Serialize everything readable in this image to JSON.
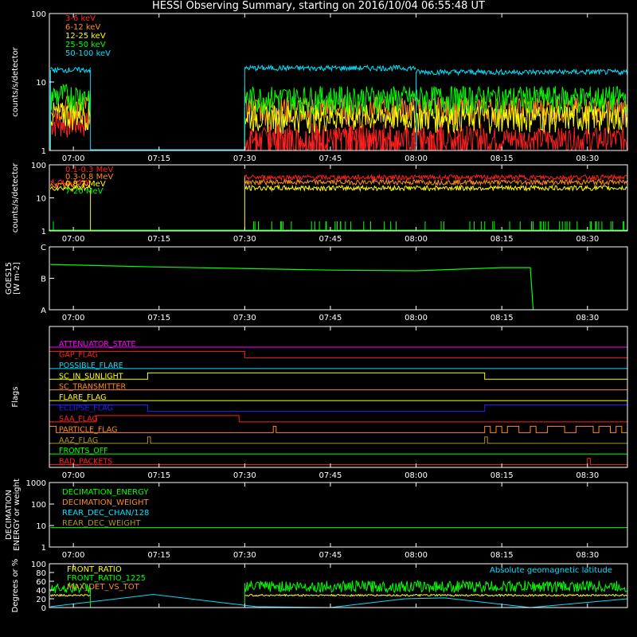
{
  "title": "HESSI Observing Summary, starting on 2016/10/04 06:55:48 UT",
  "time_axis": {
    "start": "06:55:48",
    "end": "08:37:00",
    "ticks": [
      "07:00",
      "07:15",
      "07:30",
      "07:45",
      "08:00",
      "08:15",
      "08:30"
    ]
  },
  "colors": {
    "red": "#ff2020",
    "orange": "#ff8c1a",
    "yellow": "#ffff00",
    "green": "#00ff00",
    "cyan": "#00e0ff",
    "magenta": "#ff00ff",
    "blue": "#2020ff",
    "olive": "#b09020",
    "white": "#ffffff"
  },
  "chart_data": [
    {
      "type": "line",
      "ylabel": "counts/s/detector",
      "yscale": "log",
      "ylim": [
        1,
        100
      ],
      "yticks": [
        "1",
        "10",
        "100"
      ],
      "legend": [
        {
          "name": "3-6 keV",
          "color": "#ff2020"
        },
        {
          "name": "6-12 keV",
          "color": "#ff8c1a"
        },
        {
          "name": "12-25 keV",
          "color": "#ffff00"
        },
        {
          "name": "25-50 keV",
          "color": "#00ff00"
        },
        {
          "name": "50-100 keV",
          "color": "#00e0ff"
        }
      ],
      "data_gap": [
        "07:03",
        "07:30"
      ],
      "series": [
        {
          "name": "3-6 keV",
          "color": "#ff2020",
          "segments": [
            {
              "from": "06:56",
              "to": "07:03",
              "level": 2.6
            },
            {
              "from": "07:30",
              "to": "08:37",
              "level": 1.5
            }
          ]
        },
        {
          "name": "6-12 keV",
          "color": "#ff8c1a",
          "segments": [
            {
              "from": "06:56",
              "to": "07:03",
              "level": 4.5
            },
            {
              "from": "07:30",
              "to": "08:37",
              "level": 4.2
            }
          ]
        },
        {
          "name": "12-25 keV",
          "color": "#ffff00",
          "segments": [
            {
              "from": "06:56",
              "to": "07:03",
              "level": 3.5
            },
            {
              "from": "07:30",
              "to": "08:37",
              "level": 3.2
            }
          ]
        },
        {
          "name": "25-50 keV",
          "color": "#00ff00",
          "segments": [
            {
              "from": "06:56",
              "to": "07:03",
              "level": 6.5
            },
            {
              "from": "07:30",
              "to": "08:37",
              "level": 6.0
            }
          ]
        },
        {
          "name": "50-100 keV",
          "color": "#00e0ff",
          "segments": [
            {
              "from": "06:56",
              "to": "07:03",
              "level": 15
            },
            {
              "from": "07:30",
              "to": "08:00",
              "level": 16
            },
            {
              "from": "08:00",
              "to": "08:37",
              "level": 14
            }
          ]
        }
      ]
    },
    {
      "type": "line",
      "ylabel": "counts/s/detector",
      "yscale": "log",
      "ylim": [
        1,
        100
      ],
      "yticks": [
        "1",
        "10",
        "100"
      ],
      "legend": [
        {
          "name": "0.1-0.3 MeV",
          "color": "#ff2020"
        },
        {
          "name": "0.3-0.8 MeV",
          "color": "#ff8c1a"
        },
        {
          "name": "0.8-7 MeV",
          "color": "#ffff00"
        },
        {
          "name": "7-20 MeV",
          "color": "#00ff00"
        }
      ],
      "series": [
        {
          "name": "0.1-0.3 MeV",
          "color": "#ff2020",
          "segments": [
            {
              "from": "06:56",
              "to": "07:03",
              "level": 30
            },
            {
              "from": "07:30",
              "to": "08:37",
              "level": 42
            }
          ]
        },
        {
          "name": "0.3-0.8 MeV",
          "color": "#ff8c1a",
          "segments": [
            {
              "from": "06:56",
              "to": "07:03",
              "level": 24
            },
            {
              "from": "07:30",
              "to": "08:37",
              "level": 30
            }
          ]
        },
        {
          "name": "0.8-7 MeV",
          "color": "#ffff00",
          "segments": [
            {
              "from": "06:56",
              "to": "07:03",
              "level": 20
            },
            {
              "from": "07:30",
              "to": "08:37",
              "level": 20
            }
          ]
        },
        {
          "name": "7-20 MeV",
          "color": "#00ff00",
          "segments": [
            {
              "from": "06:56",
              "to": "08:37",
              "level": 1
            }
          ]
        }
      ]
    },
    {
      "type": "line",
      "ylabel": "GOES15 [W m-2]",
      "ylabel_lines": [
        "GOES15",
        "[W m-2]"
      ],
      "yscale": "log",
      "ylim": [
        "A",
        "C"
      ],
      "yticks": [
        "A",
        "B",
        "C"
      ],
      "series": [
        {
          "name": "GOES15",
          "color": "#00ff00",
          "points": [
            [
              "06:56",
              0.72
            ],
            [
              "07:15",
              0.68
            ],
            [
              "07:45",
              0.63
            ],
            [
              "08:00",
              0.62
            ],
            [
              "08:15",
              0.67
            ],
            [
              "08:20",
              0.67
            ],
            [
              "08:20:30",
              0.0
            ]
          ]
        }
      ]
    },
    {
      "type": "line",
      "ylabel": "Flags",
      "flags": [
        {
          "name": "ATTENUATOR_STATE",
          "color": "#ff00ff",
          "transitions": []
        },
        {
          "name": "GAP_FLAG",
          "color": "#ff2020",
          "transitions": [
            [
              "06:56",
              1
            ],
            [
              "07:30",
              0
            ]
          ]
        },
        {
          "name": "POSSIBLE_FLARE",
          "color": "#00e0ff",
          "transitions": []
        },
        {
          "name": "SC_IN_SUNLIGHT",
          "color": "#ffff00",
          "transitions": [
            [
              "06:56",
              0
            ],
            [
              "07:13",
              1
            ],
            [
              "08:12",
              0
            ]
          ]
        },
        {
          "name": "SC_TRANSMITTER",
          "color": "#ff8c1a",
          "transitions": []
        },
        {
          "name": "FLARE_FLAG",
          "color": "#ffff00",
          "transitions": []
        },
        {
          "name": "ECLIPSE_FLAG",
          "color": "#2020ff",
          "transitions": [
            [
              "06:56",
              1
            ],
            [
              "07:13",
              0
            ],
            [
              "08:12",
              1
            ]
          ]
        },
        {
          "name": "SAA_FLAG",
          "color": "#ff2020",
          "transitions": [
            [
              "06:56",
              0
            ],
            [
              "07:04",
              1
            ],
            [
              "07:29",
              0
            ]
          ]
        },
        {
          "name": "PARTICLE_FLAG",
          "color": "#ff8c1a",
          "transitions": [
            [
              "06:56",
              1
            ],
            [
              "06:57",
              0
            ],
            [
              "07:35",
              1
            ],
            [
              "07:35:30",
              0
            ],
            [
              "08:12",
              1
            ],
            [
              "08:13",
              0
            ],
            [
              "08:14",
              1
            ],
            [
              "08:15",
              0
            ],
            [
              "08:16",
              1
            ],
            [
              "08:18",
              0
            ],
            [
              "08:20",
              1
            ],
            [
              "08:21",
              0
            ],
            [
              "08:23",
              1
            ],
            [
              "08:26",
              0
            ],
            [
              "08:28",
              1
            ],
            [
              "08:31",
              0
            ],
            [
              "08:32",
              1
            ],
            [
              "08:34",
              0
            ],
            [
              "08:35",
              1
            ],
            [
              "08:36",
              0
            ]
          ]
        },
        {
          "name": "AAZ_FLAG",
          "color": "#b09020",
          "transitions": [
            [
              "07:13",
              1
            ],
            [
              "07:13:30",
              0
            ],
            [
              "08:12",
              1
            ],
            [
              "08:12:30",
              0
            ]
          ]
        },
        {
          "name": "FRONTS_OFF",
          "color": "#00ff00",
          "transitions": []
        },
        {
          "name": "BAD_PACKETS",
          "color": "#ff2020",
          "transitions": [
            [
              "08:30",
              1
            ],
            [
              "08:30:30",
              0
            ]
          ]
        }
      ]
    },
    {
      "type": "line",
      "ylabel": "DECIMATION ENERGY or weight",
      "ylabel_lines": [
        "DECIMATION",
        "ENERGY or weight"
      ],
      "yscale": "log",
      "ylim": [
        1,
        1000
      ],
      "yticks": [
        "1",
        "10",
        "100",
        "1000"
      ],
      "legend": [
        {
          "name": "DECIMATION_ENERGY",
          "color": "#00ff00"
        },
        {
          "name": "DECIMATION_WEIGHT",
          "color": "#ff8c1a"
        },
        {
          "name": "REAR_DEC_CHAN/128",
          "color": "#00e0ff"
        },
        {
          "name": "REAR_DEC_WEIGHT",
          "color": "#b09020"
        }
      ],
      "series": [
        {
          "name": "DECIMATION_ENERGY",
          "color": "#00ff00",
          "segments": [
            {
              "from": "06:56",
              "to": "08:37",
              "level": 8
            }
          ]
        },
        {
          "name": "DECIMATION_WEIGHT",
          "color": "#ff8c1a",
          "segments": [
            {
              "from": "06:56",
              "to": "08:37",
              "level": 1
            }
          ]
        }
      ]
    },
    {
      "type": "line",
      "ylabel": "Degrees or %",
      "ylim": [
        0,
        100
      ],
      "yticks": [
        "0",
        "20",
        "40",
        "60",
        "80",
        "100"
      ],
      "annotation": "Absolute geomagnetic latitude",
      "legend": [
        {
          "name": "FRONT_RATIO",
          "color": "#ffff00"
        },
        {
          "name": "FRONT_RATIO_1225",
          "color": "#00ff00"
        },
        {
          "name": "MAX_DET_VS_TOT",
          "color": "#ff8c1a"
        }
      ],
      "series": [
        {
          "name": "FRONT_RATIO_1225",
          "color": "#00ff00",
          "segments": [
            {
              "from": "06:56",
              "to": "07:03",
              "level": 45
            },
            {
              "from": "07:30",
              "to": "08:37",
              "level": 48
            }
          ]
        },
        {
          "name": "FRONT_RATIO",
          "color": "#ffff00",
          "segments": [
            {
              "from": "06:56",
              "to": "07:03",
              "level": 28
            },
            {
              "from": "07:30",
              "to": "08:37",
              "level": 28
            }
          ]
        },
        {
          "name": "Absolute geomagnetic latitude",
          "color": "#00e0ff",
          "points": [
            [
              "06:56",
              2
            ],
            [
              "07:14",
              30
            ],
            [
              "07:32",
              2
            ],
            [
              "07:45",
              0
            ],
            [
              "07:58",
              20
            ],
            [
              "08:05",
              22
            ],
            [
              "08:20",
              0
            ],
            [
              "08:37",
              20
            ]
          ]
        }
      ]
    }
  ]
}
